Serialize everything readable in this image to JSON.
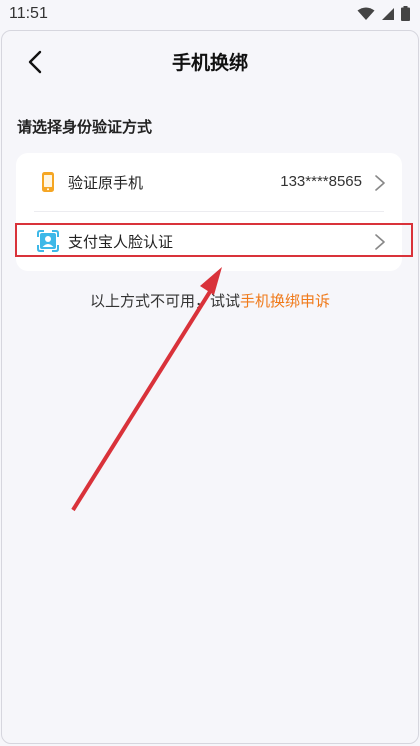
{
  "status_bar": {
    "time": "11:51"
  },
  "header": {
    "title": "手机换绑"
  },
  "section": {
    "title": "请选择身份验证方式"
  },
  "options": [
    {
      "label": "验证原手机",
      "value": "133****8565",
      "icon": "phone-icon"
    },
    {
      "label": "支付宝人脸认证",
      "value": "",
      "icon": "face-id-icon"
    }
  ],
  "footer": {
    "prefix": "以上方式不可用，试试",
    "link_label": "手机换绑申诉"
  },
  "colors": {
    "accent": "#f07a1a",
    "annotation": "#d9323a",
    "phone_icon": "#f5a623",
    "face_icon": "#3db8e8"
  }
}
